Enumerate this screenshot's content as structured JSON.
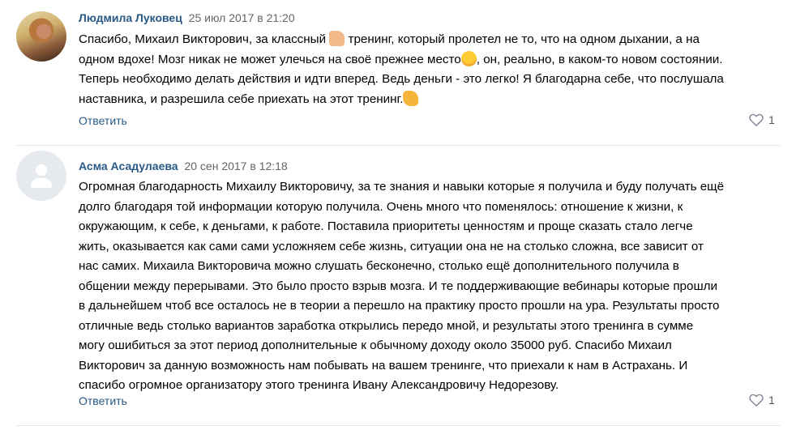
{
  "comments": [
    {
      "author": "Людмила Луковец",
      "date": "25 июл 2017 в 21:20",
      "avatar_icon": "user-photo-avatar",
      "lines": [
        [
          "Спасибо, Михаил Викторович, за классный ",
          " тренинг, который пролетел не то, что на одном дыхании, а на"
        ],
        [
          "одном вдохе! Мозг никак не может улечься на своё прежнее место",
          ", он, реально, в каком-то новом состоянии."
        ],
        [
          "Теперь необходимо делать действия и идти вперед. Ведь деньги - это легко! Я благодарна себе, что послушала"
        ],
        [
          "наставника, и разрешила себе приехать на этот тренинг."
        ]
      ],
      "emojis": [
        "thumbs-up-emoji",
        "smile-emoji",
        "clapping-hands-emoji"
      ],
      "reply_label": "Ответить",
      "likes": "1"
    },
    {
      "author": "Асма Асадулаева",
      "date": "20 сен 2017 в 12:18",
      "avatar_icon": "default-user-avatar",
      "lines": [
        "Огромная благодарность Михаилу Викторовичу, за те знания и навыки которые я получила и буду получать ещё",
        "долго благодаря той информации которую получила. Очень много что поменялось: отношение к жизни, к",
        "окружающим, к себе, к деньгами, к работе. Поставила приоритеты ценностям и проще сказать стало легче",
        "жить, оказывается как сами сами усложняем себе жизнь, ситуации она не на столько сложна, все зависит от",
        "нас самих. Михаила Викторовича можно слушать бесконечно, столько ещё дополнительного получила в",
        "общении между перерывами. Это было просто взрыв мозга. И те поддерживающие вебинары которые прошли",
        "в дальнейшем чтоб все осталось не в теории а перешло на практику просто прошли на ура. Результаты просто",
        "отличные ведь столько вариантов заработка открылись передо мной, и результаты этого тренинга в сумме",
        "могу ошибиться за этот период дополнительные к обычному доходу около 35000 руб. Спасибо Михаил",
        "Викторович за данную возможность нам побывать на вашем тренинге, что приехали к нам в Астрахань. И",
        "спасибо огромное организатору этого тренинга Ивану Александровичу Недорезову."
      ],
      "reply_label": "Ответить",
      "likes": "1"
    }
  ],
  "colors": {
    "author": "#2a5885",
    "date": "#656565",
    "link": "#2a5885",
    "divider": "#e7e8ec",
    "likes": "#4d5966"
  }
}
